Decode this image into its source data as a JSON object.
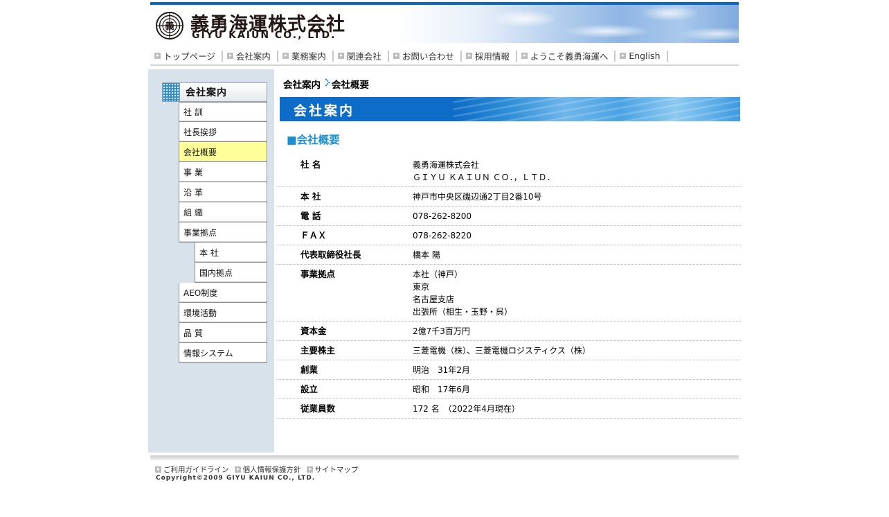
{
  "header": {
    "company_jp": "義勇海運株式会社",
    "company_en": "GIYU KAIUN CO., LTD.",
    "emblem_char": "義",
    "accent_color": "#0a67c2"
  },
  "globalnav": [
    {
      "label": "トップページ"
    },
    {
      "label": "会社案内"
    },
    {
      "label": "業務案内"
    },
    {
      "label": "関連会社"
    },
    {
      "label": "お問い合わせ"
    },
    {
      "label": "採用情報"
    },
    {
      "label": "ようこそ義勇海運へ"
    },
    {
      "label": "English"
    }
  ],
  "sidebar": {
    "heading": "会社案内",
    "items": [
      {
        "label": "社 訓"
      },
      {
        "label": "社長挨拶"
      },
      {
        "label": "会社概要",
        "active": true
      },
      {
        "label": "事 業"
      },
      {
        "label": "沿 革"
      },
      {
        "label": "組 織"
      },
      {
        "label": "事業拠点"
      },
      {
        "label": "本 社",
        "sub": true
      },
      {
        "label": "国内拠点",
        "sub": true
      },
      {
        "label": "AEO制度"
      },
      {
        "label": "環境活動"
      },
      {
        "label": "品 質"
      },
      {
        "label": "情報システム"
      }
    ]
  },
  "breadcrumb": {
    "parent": "会社案内",
    "current": "会社概要"
  },
  "banner": {
    "title": "会社案内"
  },
  "section": {
    "title": "■会社概要"
  },
  "profile": [
    {
      "key": "社 名",
      "lines": [
        "義勇海運株式会社",
        "ＧＩＹＵ ＫＡＩＵＮ ＣＯ．，ＬＴＤ．"
      ]
    },
    {
      "key": "本 社",
      "lines": [
        "神戸市中央区磯辺通2丁目2番10号"
      ]
    },
    {
      "key": "電 話",
      "lines": [
        "078-262-8200"
      ]
    },
    {
      "key": "ＦＡＸ",
      "lines": [
        "078-262-8220"
      ]
    },
    {
      "key": "代表取締役社長",
      "lines": [
        "橋本 陽"
      ]
    },
    {
      "key": "事業拠点",
      "lines": [
        "本社（神戸）",
        "東京",
        "名古屋支店",
        "出張所（相生・玉野・呉）"
      ]
    },
    {
      "key": "資本金",
      "lines": [
        "2億7千3百万円"
      ]
    },
    {
      "key": "主要株主",
      "lines": [
        "三菱電機（株）、三菱電機ロジスティクス（株）"
      ]
    },
    {
      "key": "創業",
      "lines": [
        "明治　31年2月"
      ]
    },
    {
      "key": "設立",
      "lines": [
        "昭和　17年6月"
      ]
    },
    {
      "key": "従業員数",
      "lines": [
        "172 名　（2022年4月現在）"
      ]
    }
  ],
  "footer": {
    "links": [
      {
        "label": "ご利用ガイドライン"
      },
      {
        "label": "個人情報保護方針"
      },
      {
        "label": "サイトマップ"
      }
    ],
    "copyright": "Copyright©2009 GIYU KAIUN CO., LTD."
  }
}
